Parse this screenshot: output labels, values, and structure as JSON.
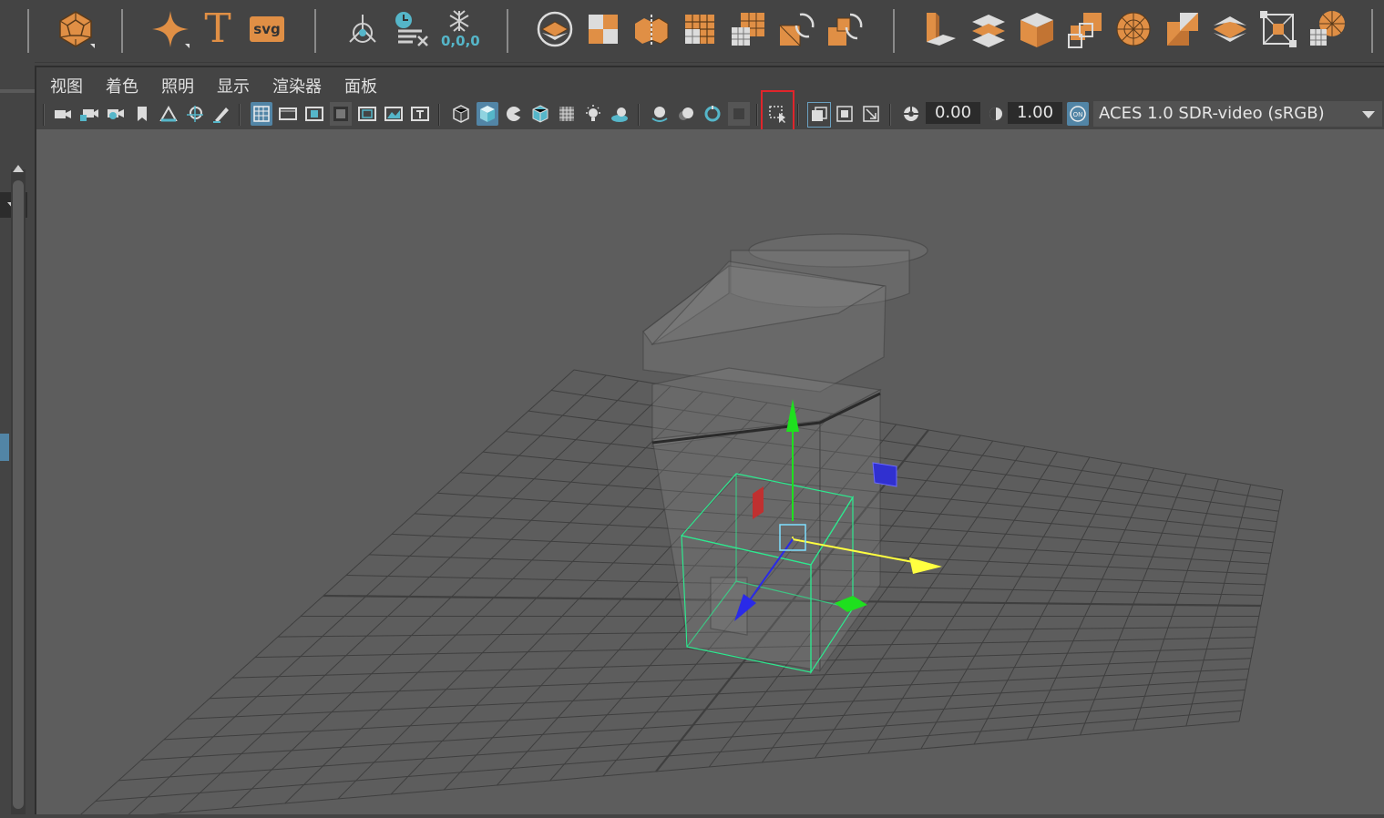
{
  "shelf": {
    "icons": [
      "polygon-sphere-icon",
      "sparkle-icon",
      "type-icon",
      "svg-icon",
      "locator-icon",
      "time-editor-icon",
      "freeze-transform-icon",
      "shelf-tool-1-icon",
      "shelf-tool-2-icon",
      "shelf-tool-3-icon",
      "shelf-tool-4-icon",
      "shelf-tool-5-icon",
      "shelf-tool-6-icon",
      "shelf-tool-7-icon",
      "shelf-tool-8-icon",
      "shelf-tool-9-icon",
      "shelf-tool-10-icon",
      "shelf-tool-11-icon",
      "shelf-tool-12-icon",
      "shelf-tool-13-icon",
      "shelf-tool-14-icon",
      "shelf-tool-15-icon",
      "shelf-tool-16-icon",
      "shelf-tool-17-icon"
    ],
    "type_glyph": "T",
    "svg_label": "svg",
    "freeze_value": "0,0,0",
    "accent_color": "#e08f45",
    "teal_color": "#55b6c9"
  },
  "menu": {
    "items": [
      "视图",
      "着色",
      "照明",
      "显示",
      "渲染器",
      "面板"
    ]
  },
  "toolbar": {
    "exposure": "0.00",
    "gamma": "1.00",
    "color_space": "ACES 1.0 SDR-video (sRGB)",
    "icons": [
      "camera-icon",
      "camera-lock-icon",
      "camera-attributes-icon",
      "bookmark-icon",
      "image-plane-icon",
      "2d-pan-zoom-icon",
      "grease-pencil-icon",
      "grid-icon",
      "film-gate-icon",
      "resolution-gate-icon",
      "gate-mask-icon",
      "field-chart-icon",
      "safe-action-icon",
      "safe-title-icon",
      "wireframe-icon",
      "smooth-shade-icon",
      "default-material-icon",
      "wireframe-on-shaded-icon",
      "xray-icon",
      "use-all-lights-icon",
      "shadows-icon",
      "screen-space-ao-icon",
      "motion-blur-icon",
      "anti-aliasing-icon",
      "depth-of-field-icon",
      "select-camera-icon",
      "isolate-select-icon",
      "xray-joints-icon",
      "xray-active-components-icon",
      "exposure-icon",
      "gamma-icon",
      "color-management-icon"
    ],
    "highlight_color": "#e0252b"
  },
  "viewport": {
    "background": "#5d5d5d",
    "grid_color": "#3f3f3f",
    "selection_color": "#2ee88f",
    "axis_colors": {
      "x": "#ffff40",
      "y": "#1ee01e",
      "z": "#2a2ae8",
      "plane_x": "#c03030"
    }
  }
}
